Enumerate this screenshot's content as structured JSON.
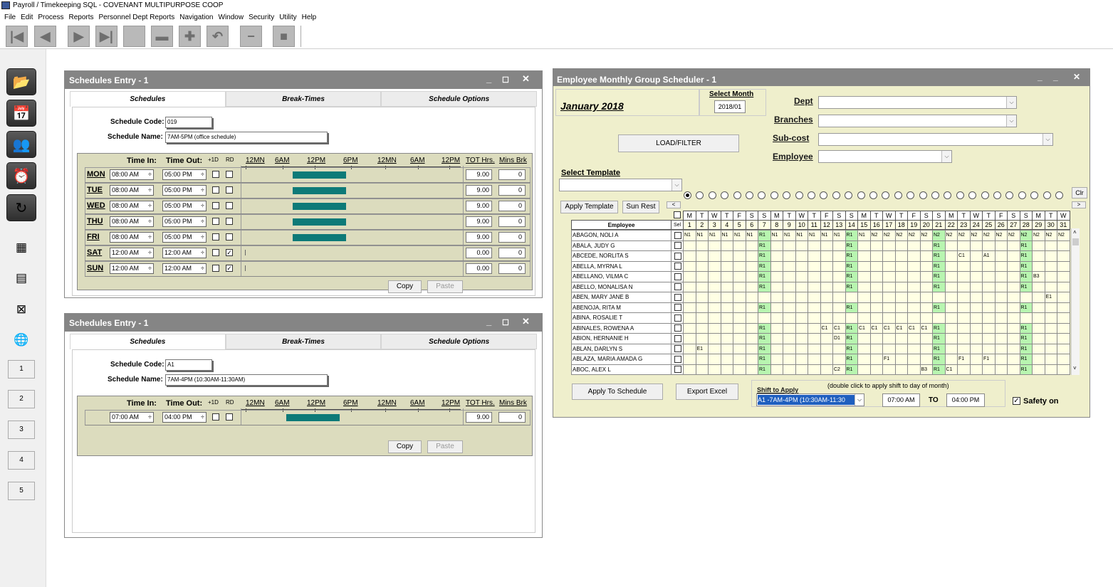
{
  "app": {
    "title": "Payroll / Timekeeping SQL - COVENANT MULTIPURPOSE COOP"
  },
  "menu": [
    "File",
    "Edit",
    "Process",
    "Reports",
    "Personnel Dept Reports",
    "Navigation",
    "Window",
    "Security",
    "Utility",
    "Help"
  ],
  "toolbar": {
    "icons": [
      "first-record-icon",
      "previous-record-icon",
      "next-record-icon",
      "last-record-icon",
      "blank-icon",
      "save-icon",
      "add-icon",
      "undo-icon",
      "delete-icon",
      "stop-icon"
    ]
  },
  "sidebar": {
    "numbers": [
      "1",
      "2",
      "3",
      "4",
      "5"
    ]
  },
  "win1": {
    "title": "Schedules Entry - 1",
    "tabs": [
      "Schedules",
      "Break-Times",
      "Schedule Options"
    ],
    "code_label": "Schedule Code:",
    "code": "019",
    "name_label": "Schedule Name:",
    "name": "7AM-5PM (office schedule)",
    "headers": {
      "time_in": "Time In:",
      "time_out": "Time Out:",
      "plus1d": "+1D",
      "rd": "RD",
      "tot": "TOT Hrs.",
      "mins": "Mins Brk",
      "tl": [
        "12MN",
        "6AM",
        "12PM",
        "6PM",
        "12MN",
        "6AM",
        "12PM"
      ]
    },
    "rows": [
      {
        "day": "MON",
        "in": "08:00 AM",
        "out": "05:00 PM",
        "plus1d": false,
        "rd": false,
        "tot": "9.00",
        "brk": "0",
        "bar": true
      },
      {
        "day": "TUE",
        "in": "08:00 AM",
        "out": "05:00 PM",
        "plus1d": false,
        "rd": false,
        "tot": "9.00",
        "brk": "0",
        "bar": true
      },
      {
        "day": "WED",
        "in": "08:00 AM",
        "out": "05:00 PM",
        "plus1d": false,
        "rd": false,
        "tot": "9.00",
        "brk": "0",
        "bar": true
      },
      {
        "day": "THU",
        "in": "08:00 AM",
        "out": "05:00 PM",
        "plus1d": false,
        "rd": false,
        "tot": "9.00",
        "brk": "0",
        "bar": true
      },
      {
        "day": "FRI",
        "in": "08:00 AM",
        "out": "05:00 PM",
        "plus1d": false,
        "rd": false,
        "tot": "9.00",
        "brk": "0",
        "bar": true
      },
      {
        "day": "SAT",
        "in": "12:00 AM",
        "out": "12:00 AM",
        "plus1d": false,
        "rd": true,
        "tot": "0.00",
        "brk": "0",
        "bar": false
      },
      {
        "day": "SUN",
        "in": "12:00 AM",
        "out": "12:00 AM",
        "plus1d": false,
        "rd": true,
        "tot": "0.00",
        "brk": "0",
        "bar": false
      }
    ],
    "copy": "Copy",
    "paste": "Paste"
  },
  "win2": {
    "title": "Schedules Entry - 1",
    "tabs": [
      "Schedules",
      "Break-Times",
      "Schedule Options"
    ],
    "code_label": "Schedule Code:",
    "code": "A1",
    "name_label": "Schedule Name:",
    "name": "7AM-4PM (10:30AM-11:30AM)",
    "row": {
      "in": "07:00 AM",
      "out": "04:00 PM",
      "tot": "9.00",
      "brk": "0"
    },
    "copy": "Copy",
    "paste": "Paste"
  },
  "win3": {
    "title": "Employee Monthly Group Scheduler - 1",
    "month_label": "January  2018",
    "select_month": "Select Month",
    "month_value": "2018/01",
    "dept": "Dept",
    "branches": "Branches",
    "subcost": "Sub-cost",
    "employee": "Employee",
    "load_filter": "LOAD/FILTER",
    "select_template": "Select Template",
    "apply_template": "Apply Template",
    "sun_rest": "Sun Rest",
    "clr": "Clr",
    "prev": "<",
    "next": ">",
    "col_employee": "Employee",
    "col_sel": "Sel",
    "dow": [
      "M",
      "T",
      "W",
      "T",
      "F",
      "S",
      "S",
      "M",
      "T",
      "W",
      "T",
      "F",
      "S",
      "S",
      "M",
      "T",
      "W",
      "T",
      "F",
      "S",
      "S",
      "M",
      "T",
      "W",
      "T",
      "F",
      "S",
      "S",
      "M",
      "T",
      "W"
    ],
    "days": [
      "1",
      "2",
      "3",
      "4",
      "5",
      "6",
      "7",
      "8",
      "9",
      "10",
      "11",
      "12",
      "13",
      "14",
      "15",
      "16",
      "17",
      "18",
      "19",
      "20",
      "21",
      "22",
      "23",
      "24",
      "25",
      "26",
      "27",
      "28",
      "29",
      "30",
      "31"
    ],
    "employees": [
      {
        "name": "ABAGON, NOLI  A",
        "cells": {
          "1": "N1",
          "2": "N1",
          "3": "N1",
          "4": "N1",
          "5": "N1",
          "6": "N1",
          "7": "R1",
          "8": "N1",
          "9": "N1",
          "10": "N1",
          "11": "N1",
          "12": "N1",
          "13": "N1",
          "14": "R1",
          "15": "N1",
          "16": "N2",
          "17": "N2",
          "18": "N2",
          "19": "N2",
          "20": "N2",
          "21": "N2",
          "22": "N2",
          "23": "N2",
          "24": "N2",
          "25": "N2",
          "26": "N2",
          "27": "N2",
          "28": "N2",
          "29": "N2",
          "30": "N2",
          "31": "N2"
        }
      },
      {
        "name": "ABALA, JUDY  G",
        "cells": {
          "7": "R1",
          "14": "R1",
          "21": "R1",
          "28": "R1"
        }
      },
      {
        "name": "ABCEDE, NORLITA  S",
        "cells": {
          "7": "R1",
          "14": "R1",
          "21": "R1",
          "23": "C1",
          "25": "A1",
          "28": "R1"
        }
      },
      {
        "name": "ABELLA, MYRNA  L",
        "cells": {
          "7": "R1",
          "14": "R1",
          "21": "R1",
          "28": "R1"
        }
      },
      {
        "name": "ABELLANO, VILMA  C",
        "cells": {
          "7": "R1",
          "14": "R1",
          "21": "R1",
          "28": "R1",
          "29": "B3"
        }
      },
      {
        "name": "ABELLO, MONALISA  N",
        "cells": {
          "7": "R1",
          "14": "R1",
          "21": "R1",
          "28": "R1"
        }
      },
      {
        "name": "ABEN, MARY JANE  B",
        "cells": {
          "30": "E1"
        }
      },
      {
        "name": "ABENOJA, RITA  M",
        "cells": {
          "7": "R1",
          "14": "R1",
          "21": "R1",
          "28": "R1"
        }
      },
      {
        "name": "ABINA, ROSALIE  T",
        "cells": {}
      },
      {
        "name": "ABINALES, ROWENA  A",
        "cells": {
          "7": "R1",
          "12": "C1",
          "13": "C1",
          "14": "R1",
          "15": "C1",
          "16": "C1",
          "17": "C1",
          "18": "C1",
          "19": "C1",
          "20": "C1",
          "21": "R1",
          "28": "R1"
        }
      },
      {
        "name": "ABION, HERNANIE  H",
        "cells": {
          "7": "R1",
          "13": "D1",
          "14": "R1",
          "21": "R1",
          "28": "R1"
        }
      },
      {
        "name": "ABLAN, DARLYN  S",
        "cells": {
          "2": "E1",
          "7": "R1",
          "14": "R1",
          "21": "R1",
          "28": "R1"
        }
      },
      {
        "name": "ABLAZA, MARIA AMADA  G",
        "cells": {
          "7": "R1",
          "14": "R1",
          "17": "F1",
          "21": "R1",
          "23": "F1",
          "25": "F1",
          "28": "R1"
        }
      },
      {
        "name": "ABOC, ALEX  L",
        "cells": {
          "7": "R1",
          "13": "C2",
          "14": "R1",
          "20": "B3",
          "21": "R1",
          "22": "C1",
          "28": "R1"
        }
      }
    ],
    "green_days": [
      "7",
      "14",
      "21",
      "28"
    ],
    "apply_schedule": "Apply To Schedule",
    "export_excel": "Export Excel",
    "shift_label": "Shift to Apply",
    "shift_hint": "(double click to apply shift to day of month)",
    "shift_value": "A1 -7AM-4PM (10:30AM-11:30",
    "time_from": "07:00 AM",
    "to": "TO",
    "time_to": "04:00 PM",
    "safety": "Safety on"
  }
}
